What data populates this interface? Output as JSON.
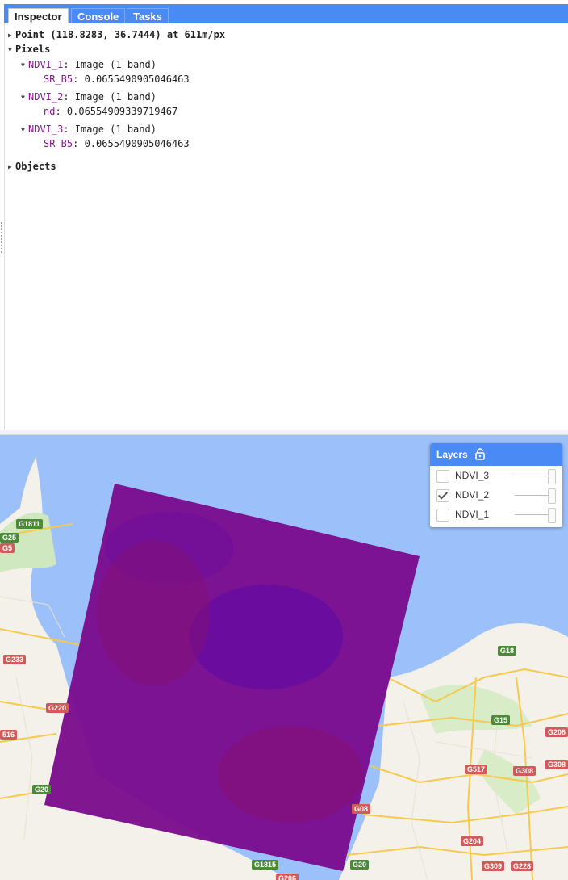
{
  "tabs": [
    "Inspector",
    "Console",
    "Tasks"
  ],
  "inspector": {
    "point": "Point (118.8283, 36.7444) at 611m/px",
    "pixels_label": "Pixels",
    "layers": [
      {
        "name": "NDVI_1",
        "type": ": Image (1 band)",
        "band": "SR_B5",
        "value": ": 0.0655490905046463"
      },
      {
        "name": "NDVI_2",
        "type": ": Image (1 band)",
        "band": "nd",
        "value": ": 0.06554909339719467"
      },
      {
        "name": "NDVI_3",
        "type": ": Image (1 band)",
        "band": "SR_B5",
        "value": ": 0.0655490905046463"
      }
    ],
    "objects_label": "Objects"
  },
  "layers_panel": {
    "title": "Layers",
    "items": [
      {
        "name": "NDVI_3",
        "checked": false
      },
      {
        "name": "NDVI_2",
        "checked": true
      },
      {
        "name": "NDVI_1",
        "checked": false
      }
    ]
  },
  "map_labels": {
    "g1811": "G1811",
    "g25": "G25",
    "g5": "G5",
    "g233": "G233",
    "g220": "G220",
    "s16": "516",
    "g20a": "G20",
    "g18": "G18",
    "g15": "G15",
    "g206a": "G206",
    "g308a": "G308",
    "g517": "G517",
    "g308b": "G308",
    "g08": "G08",
    "g204": "G204",
    "g1815": "G1815",
    "g20b": "G20",
    "g309": "G309",
    "g228": "G228",
    "g206b": "G206"
  },
  "colors": {
    "accent": "#4a8af4",
    "overlay": "#7a0a8c",
    "sea": "#9cc0f9",
    "land": "#f4f1ea"
  }
}
